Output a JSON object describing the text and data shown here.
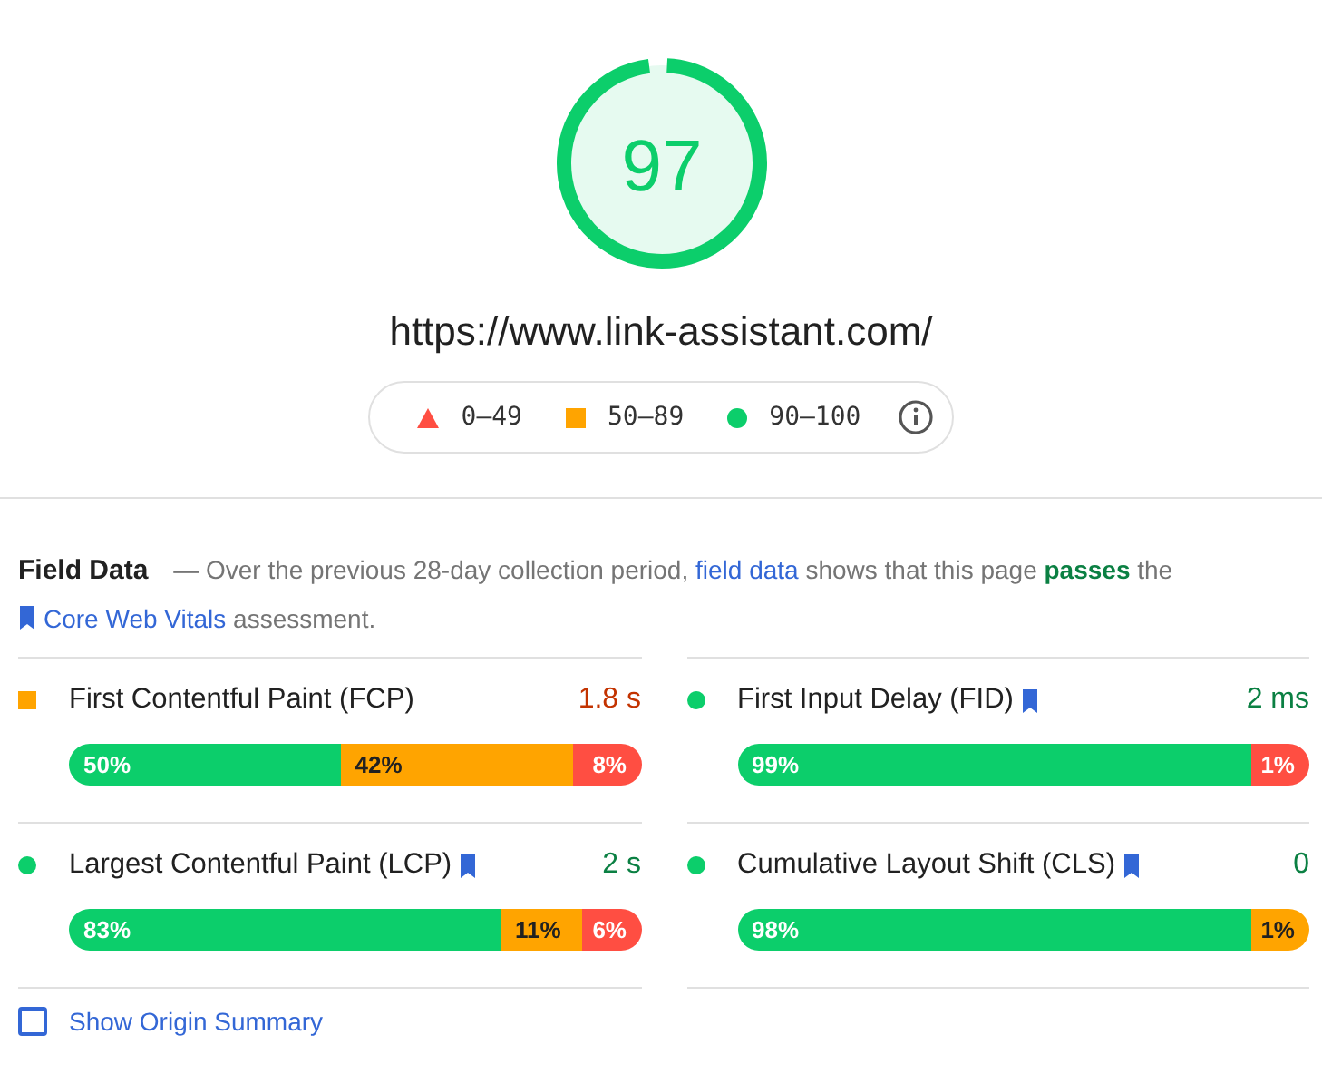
{
  "score": {
    "value": "97",
    "level": 0.97
  },
  "url": "https://www.link-assistant.com/",
  "legend": [
    {
      "kind": "triangle",
      "label": "0–49",
      "color": "#ff4e42"
    },
    {
      "kind": "square",
      "label": "50–89",
      "color": "#ffa400"
    },
    {
      "kind": "circle",
      "label": "90–100",
      "color": "#0cce6b"
    }
  ],
  "field_data": {
    "title": "Field Data",
    "dash": "—",
    "intro": "Over the previous 28-day collection period,",
    "link": "field data",
    "rest": "shows that this page **passes** the",
    "vitals_link": "Core Web Vitals",
    "tail": "assessment."
  },
  "metrics": [
    {
      "name": "First Contentful Paint (FCP)",
      "kind": "square",
      "color": "#ffa400",
      "bookmark": false,
      "value": "1.8 s",
      "segments": [
        {
          "label": "50%",
          "color": "#0cce6b"
        },
        {
          "label": "42%",
          "color": "#ffa400"
        },
        {
          "label": "8%",
          "color": "#ff4e42"
        }
      ]
    },
    {
      "name": "First Input Delay (FID)",
      "kind": "circle",
      "color": "#0cce6b",
      "bookmark": true,
      "value": "2 ms",
      "segments": [
        {
          "label": "99%",
          "color": "#0cce6b"
        },
        {
          "label": "1%",
          "color": "#ff4e42"
        }
      ]
    },
    {
      "name": "Largest Contentful Paint (LCP)",
      "kind": "circle",
      "color": "#0cce6b",
      "bookmark": true,
      "value": "2 s",
      "segments": [
        {
          "label": "83%",
          "color": "#0cce6b"
        },
        {
          "label": "11%",
          "color": "#ffa400"
        },
        {
          "label": "6%",
          "color": "#ff4e42"
        }
      ]
    },
    {
      "name": "Cumulative Layout Shift (CLS)",
      "kind": "circle",
      "color": "#0cce6b",
      "bookmark": true,
      "value": "0",
      "segments": [
        {
          "label": "98%",
          "color": "#0cce6b"
        },
        {
          "label": "1%",
          "color": "#ffa400"
        }
      ]
    }
  ],
  "origin_summary": {
    "label": "Show Origin Summary",
    "checked": false
  }
}
